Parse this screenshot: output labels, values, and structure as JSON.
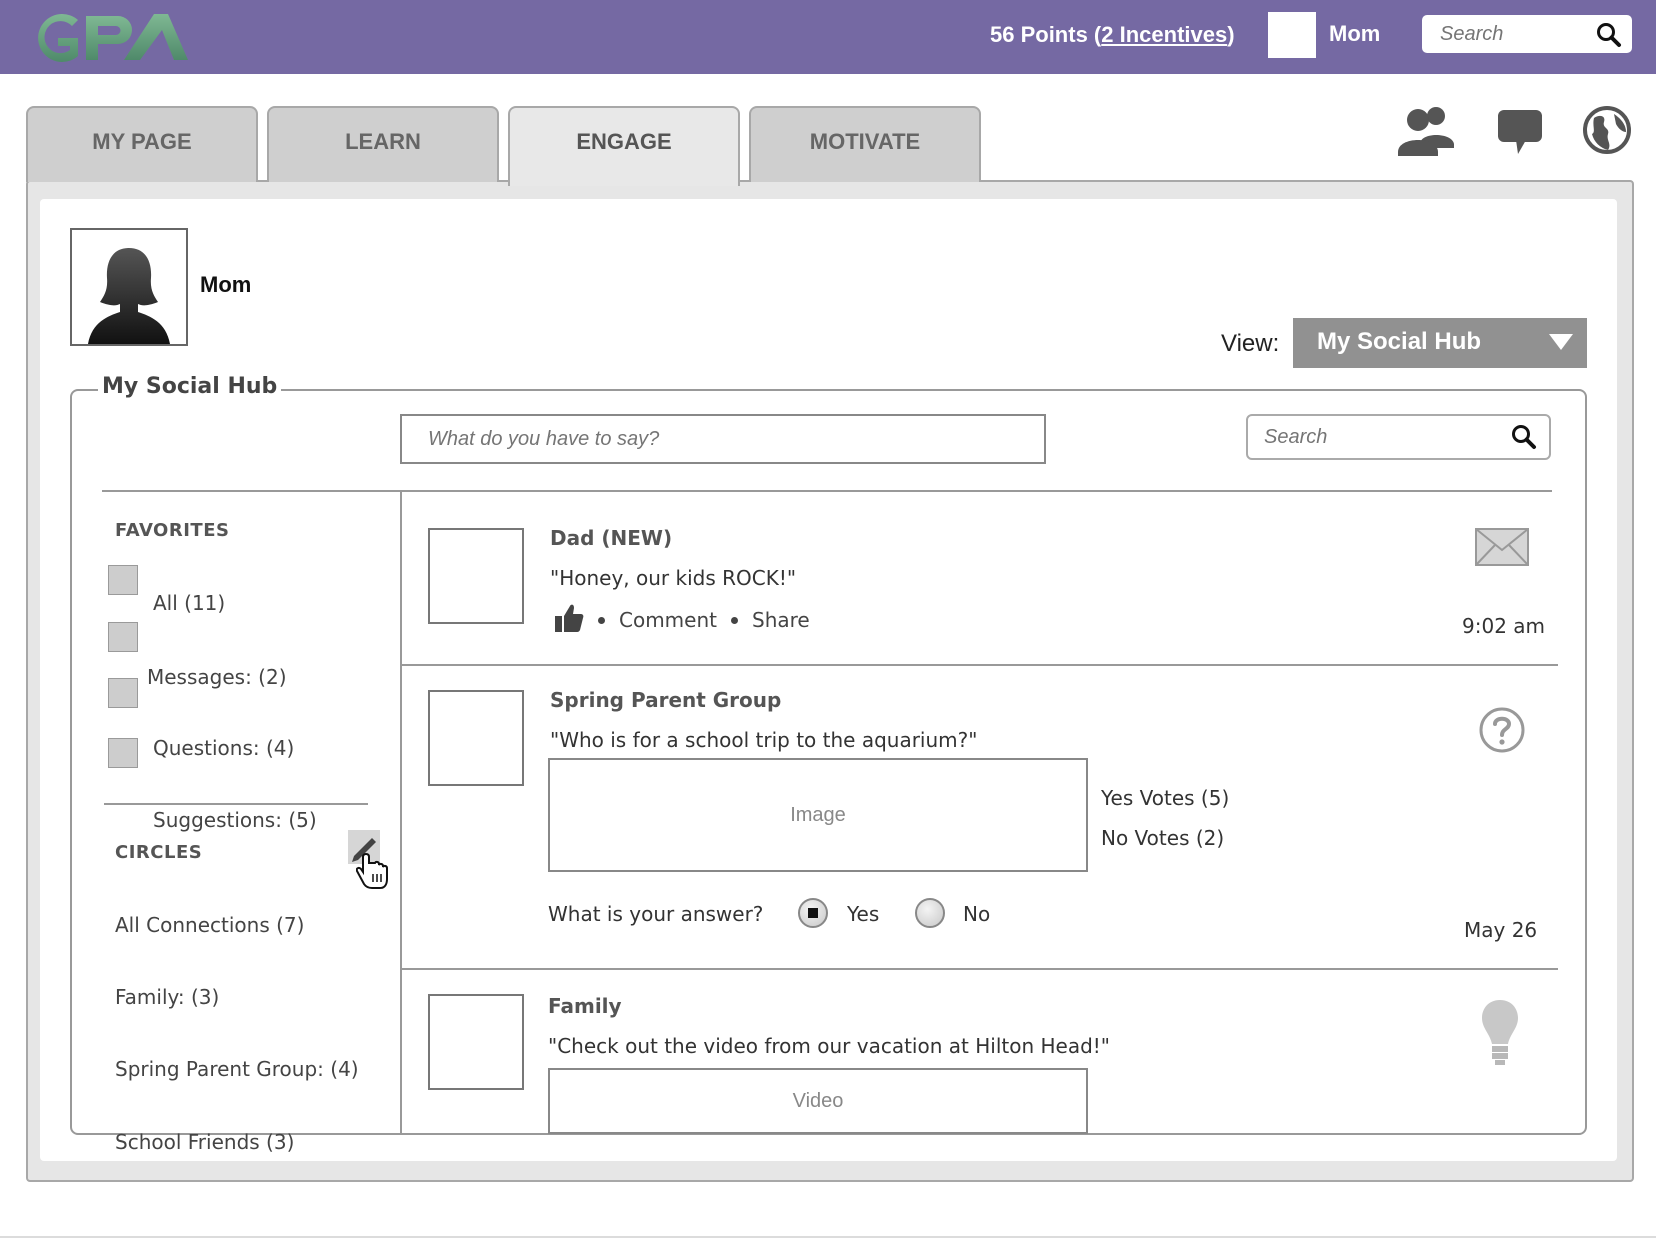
{
  "header": {
    "logo_text": "GPA",
    "points_text": "56 Points",
    "points_open": " (",
    "incentives_link": "2 Incentives",
    "points_close": ")",
    "user_name": "Mom",
    "search_placeholder": "Search"
  },
  "tabs": [
    {
      "label": "MY PAGE"
    },
    {
      "label": "LEARN"
    },
    {
      "label": "ENGAGE",
      "active": true
    },
    {
      "label": "MOTIVATE"
    }
  ],
  "header_icons": [
    "people-icon",
    "chat-icon",
    "globe-icon"
  ],
  "profile": {
    "name": "Mom"
  },
  "view": {
    "label": "View:",
    "selected": "My Social Hub"
  },
  "hub": {
    "title": "My Social Hub",
    "compose_placeholder": "What do you have to say?",
    "search_placeholder": "Search"
  },
  "sidebar": {
    "favorites_heading": "FAVORITES",
    "favorites": [
      "All (11)",
      "Messages: (2)",
      "Questions: (4)",
      "Suggestions: (5)"
    ],
    "circles_heading": "CIRCLES",
    "circles": [
      "All Connections (7)",
      "Family: (3)",
      "Spring Parent Group: (4)",
      "School Friends (3)"
    ]
  },
  "feed": {
    "posts": [
      {
        "title": "Dad (NEW)",
        "text": "\"Honey, our kids ROCK!\"",
        "comment_label": "Comment",
        "share_label": "Share",
        "time": "9:02 am",
        "type_icon": "envelope-icon"
      },
      {
        "title": "Spring Parent Group",
        "text": "\"Who is for a school trip to the aquarium?\"",
        "media_label": "Image",
        "yes_votes": "Yes Votes (5)",
        "no_votes": "No Votes (2)",
        "question": "What is your answer?",
        "yes_label": "Yes",
        "no_label": "No",
        "selected_answer": "Yes",
        "time": "May 26",
        "type_icon": "question-icon"
      },
      {
        "title": "Family",
        "text": "\"Check out the video from our vacation at Hilton Head!\"",
        "media_label": "Video",
        "type_icon": "lightbulb-icon"
      }
    ]
  },
  "colors": {
    "header_bg": "#7569a3",
    "logo_green": "#5f9c7c",
    "tab_bg": "#cfcfcf",
    "panel_bg": "#e6e6e6",
    "dropdown_bg": "#919191"
  }
}
